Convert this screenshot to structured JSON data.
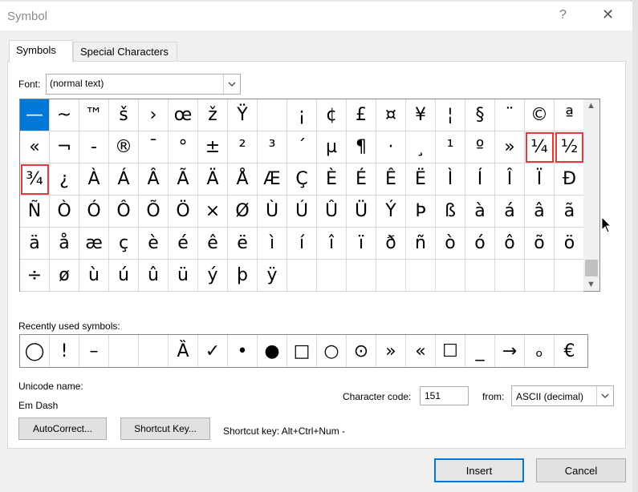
{
  "window": {
    "title": "Symbol",
    "help_label": "?",
    "close_label": "✕"
  },
  "tabs": [
    {
      "label": "Symbols"
    },
    {
      "label": "Special Characters"
    }
  ],
  "font": {
    "label": "Font:",
    "value": "(normal text)"
  },
  "symbol_grid": [
    "—",
    "~",
    "™",
    "š",
    "›",
    "œ",
    "ž",
    "Ÿ",
    " ",
    "¡",
    "¢",
    "£",
    "¤",
    "¥",
    "¦",
    "§",
    "¨",
    "©",
    "ª",
    "«",
    "¬",
    "-",
    "®",
    "¯",
    "°",
    "±",
    "²",
    "³",
    "´",
    "µ",
    "¶",
    "·",
    "¸",
    "¹",
    "º",
    "»",
    "¼",
    "½",
    "¾",
    "¿",
    "À",
    "Á",
    "Â",
    "Ã",
    "Ä",
    "Å",
    "Æ",
    "Ç",
    "È",
    "É",
    "Ê",
    "Ë",
    "Ì",
    "Í",
    "Î",
    "Ï",
    "Ð",
    "Ñ",
    "Ò",
    "Ó",
    "Ô",
    "Õ",
    "Ö",
    "×",
    "Ø",
    "Ù",
    "Ú",
    "Û",
    "Ü",
    "Ý",
    "Þ",
    "ß",
    "à",
    "á",
    "â",
    "ã",
    "ä",
    "å",
    "æ",
    "ç",
    "è",
    "é",
    "ê",
    "ë",
    "ì",
    "í",
    "î",
    "ï",
    "ð",
    "ñ",
    "ò",
    "ó",
    "ô",
    "õ",
    "ö",
    "÷",
    "ø",
    "ù",
    "ú",
    "û",
    "ü",
    "ý",
    "þ",
    "ÿ",
    "",
    "",
    "",
    "",
    "",
    "",
    "",
    "",
    "",
    ""
  ],
  "recent": {
    "label": "Recently used symbols:",
    "symbols": [
      "◯",
      "!",
      "–",
      "",
      "",
      "Ȁ",
      "✓",
      "•",
      "●",
      "□",
      "○",
      "⊙",
      "»",
      "«",
      "☐",
      "_",
      "→",
      "ₒ",
      "€"
    ]
  },
  "unicode": {
    "label": "Unicode name:",
    "value": "Em Dash"
  },
  "char_code": {
    "label": "Character code:",
    "value": "151"
  },
  "from": {
    "label": "from:",
    "value": "ASCII (decimal)"
  },
  "buttons": {
    "autocorrect": "AutoCorrect...",
    "shortcut_key": "Shortcut Key...",
    "insert": "Insert",
    "cancel": "Cancel"
  },
  "shortcut_text": "Shortcut key: Alt+Ctrl+Num -",
  "colors": {
    "selection": "#0078d7",
    "highlight": "#e03c3c"
  }
}
